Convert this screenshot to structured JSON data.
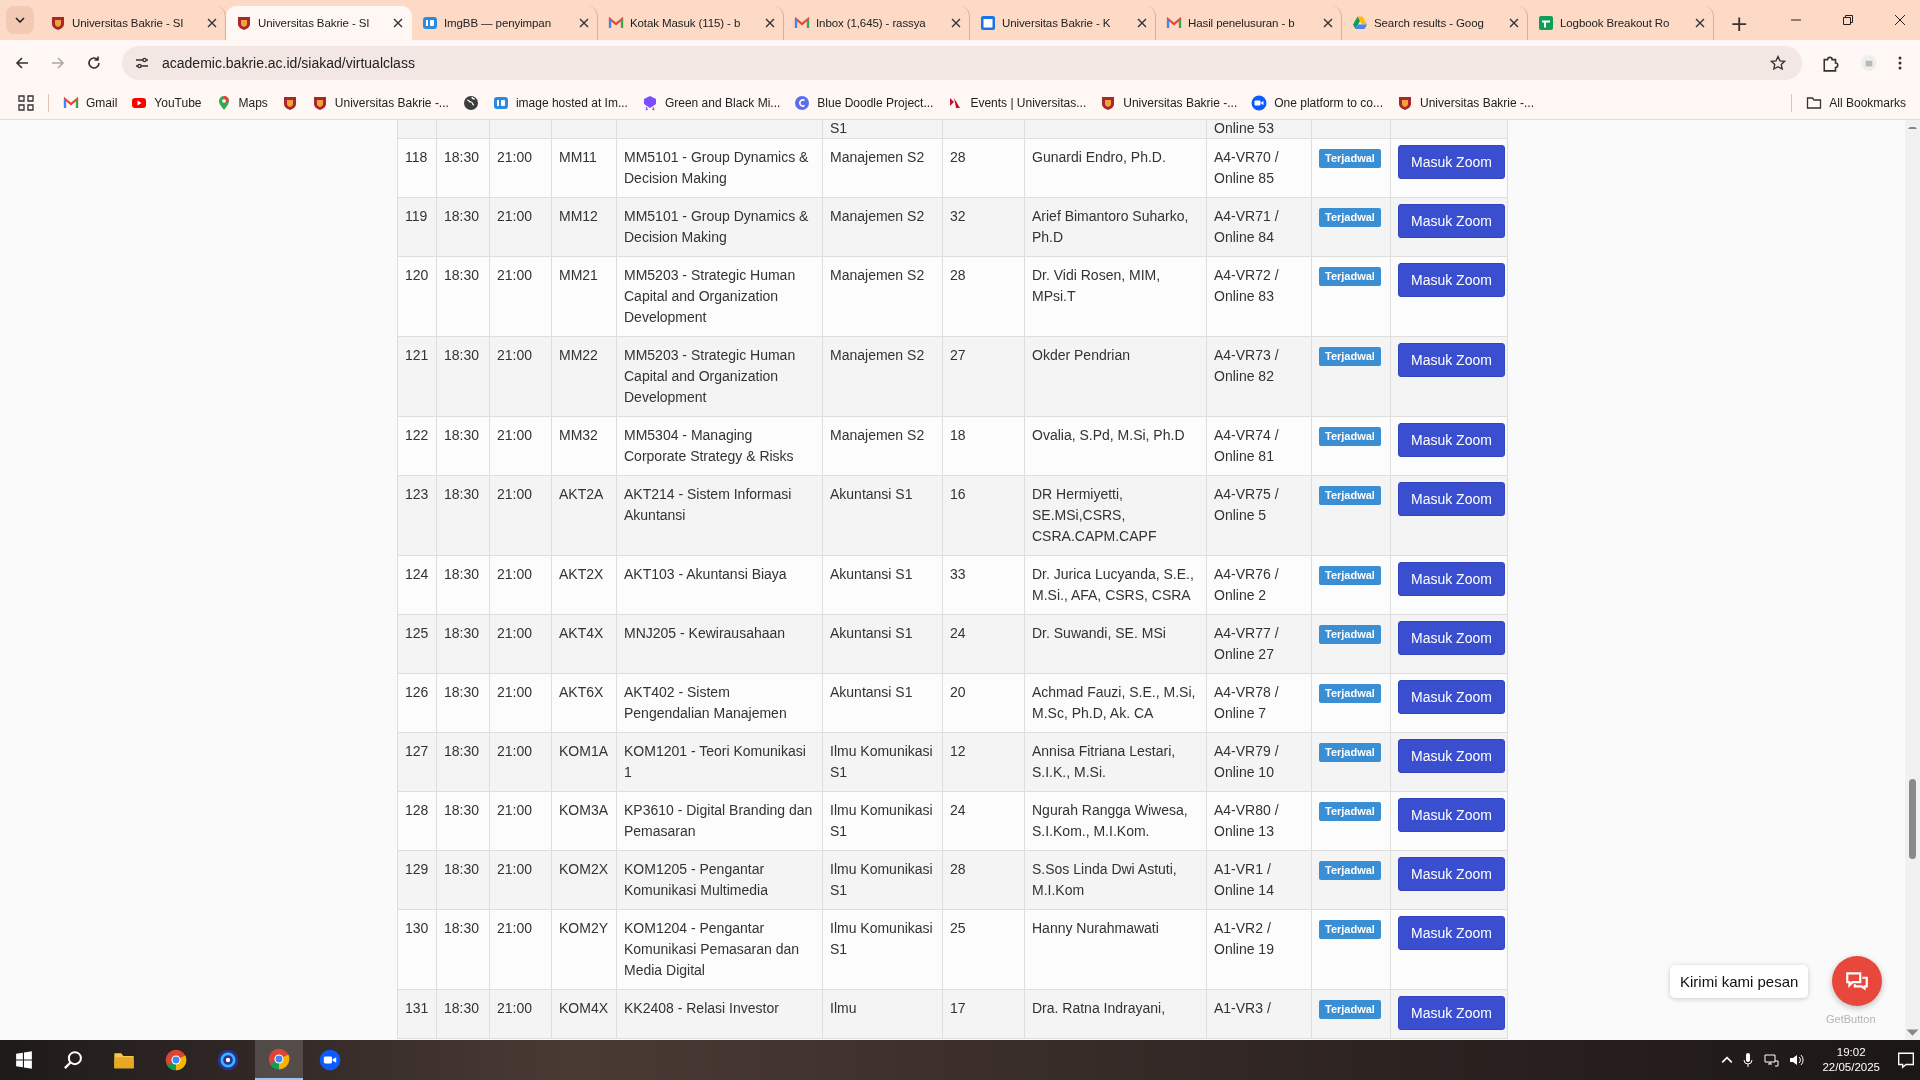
{
  "browser": {
    "tabs": [
      {
        "kind": "bakrie",
        "title": "Universitas Bakrie - SI",
        "selected": false
      },
      {
        "kind": "bakrie",
        "title": "Universitas Bakrie - SI",
        "selected": true
      },
      {
        "kind": "ibb",
        "title": "ImgBB — penyimpan",
        "selected": false
      },
      {
        "kind": "gmail",
        "title": "Kotak Masuk (115) - b",
        "selected": false
      },
      {
        "kind": "gmail",
        "title": "Inbox (1,645) - rassya",
        "selected": false
      },
      {
        "kind": "calendar",
        "title": "Universitas Bakrie - K",
        "selected": false
      },
      {
        "kind": "gmail",
        "title": "Hasil penelusuran - b",
        "selected": false
      },
      {
        "kind": "drive",
        "title": "Search results - Goog",
        "selected": false
      },
      {
        "kind": "sheets",
        "title": "Logbook Breakout Ro",
        "selected": false
      }
    ],
    "new_tab": "+",
    "address": "academic.bakrie.ac.id/siakad/virtualclass",
    "bookmarks": [
      {
        "kind": "gmail",
        "label": "Gmail"
      },
      {
        "kind": "youtube",
        "label": "YouTube"
      },
      {
        "kind": "maps",
        "label": "Maps"
      },
      {
        "kind": "bakrie"
      },
      {
        "kind": "bakrie",
        "label": "Universitas Bakrie -..."
      },
      {
        "kind": "globe"
      },
      {
        "kind": "ibb",
        "label": "image hosted at Im..."
      },
      {
        "kind": "badge",
        "label": "Green and Black Mi..."
      },
      {
        "kind": "doodle",
        "label": "Blue Doodle Project..."
      },
      {
        "kind": "events",
        "label": "Events | Universitas..."
      },
      {
        "kind": "bakrie",
        "label": "Universitas Bakrie -..."
      },
      {
        "kind": "zoom",
        "label": "One platform to co..."
      },
      {
        "kind": "bakrie",
        "label": "Universitas Bakrie -..."
      }
    ],
    "all_bookmarks": "All Bookmarks"
  },
  "table": {
    "partial_row": {
      "prodi": "S1",
      "room": "Online 53"
    },
    "rows": [
      {
        "no": "118",
        "start": "18:30",
        "end": "21:00",
        "code": "MM11",
        "course": "MM5101 - Group Dynamics & Decision Making",
        "prodi": "Manajemen S2",
        "participants": "28",
        "lecturer": "Gunardi Endro, Ph.D.",
        "room": "A4-VR70 / Online 85",
        "status": "Terjadwal",
        "action": "Masuk Zoom"
      },
      {
        "no": "119",
        "start": "18:30",
        "end": "21:00",
        "code": "MM12",
        "course": "MM5101 - Group Dynamics & Decision Making",
        "prodi": "Manajemen S2",
        "participants": "32",
        "lecturer": "Arief Bimantoro Suharko, Ph.D",
        "room": "A4-VR71 / Online 84",
        "status": "Terjadwal",
        "action": "Masuk Zoom"
      },
      {
        "no": "120",
        "start": "18:30",
        "end": "21:00",
        "code": "MM21",
        "course": "MM5203 - Strategic Human Capital and Organization Development",
        "prodi": "Manajemen S2",
        "participants": "28",
        "lecturer": "Dr. Vidi Rosen, MIM, MPsi.T",
        "room": "A4-VR72 / Online 83",
        "status": "Terjadwal",
        "action": "Masuk Zoom"
      },
      {
        "no": "121",
        "start": "18:30",
        "end": "21:00",
        "code": "MM22",
        "course": "MM5203 - Strategic Human Capital and Organization Development",
        "prodi": "Manajemen S2",
        "participants": "27",
        "lecturer": "Okder Pendrian",
        "room": "A4-VR73 / Online 82",
        "status": "Terjadwal",
        "action": "Masuk Zoom"
      },
      {
        "no": "122",
        "start": "18:30",
        "end": "21:00",
        "code": "MM32",
        "course": "MM5304 - Managing Corporate Strategy & Risks",
        "prodi": "Manajemen S2",
        "participants": "18",
        "lecturer": "Ovalia, S.Pd, M.Si, Ph.D",
        "room": "A4-VR74 / Online 81",
        "status": "Terjadwal",
        "action": "Masuk Zoom"
      },
      {
        "no": "123",
        "start": "18:30",
        "end": "21:00",
        "code": "AKT2A",
        "course": "AKT214 - Sistem Informasi Akuntansi",
        "prodi": "Akuntansi S1",
        "participants": "16",
        "lecturer": "DR Hermiyetti, SE.MSi,CSRS, CSRA.CAPM.CAPF",
        "room": "A4-VR75 / Online 5",
        "status": "Terjadwal",
        "action": "Masuk Zoom"
      },
      {
        "no": "124",
        "start": "18:30",
        "end": "21:00",
        "code": "AKT2X",
        "course": "AKT103 - Akuntansi Biaya",
        "prodi": "Akuntansi S1",
        "participants": "33",
        "lecturer": "Dr. Jurica Lucyanda, S.E., M.Si., AFA, CSRS, CSRA",
        "room": "A4-VR76 / Online 2",
        "status": "Terjadwal",
        "action": "Masuk Zoom"
      },
      {
        "no": "125",
        "start": "18:30",
        "end": "21:00",
        "code": "AKT4X",
        "course": "MNJ205 - Kewirausahaan",
        "prodi": "Akuntansi S1",
        "participants": "24",
        "lecturer": "Dr. Suwandi, SE. MSi",
        "room": "A4-VR77 / Online 27",
        "status": "Terjadwal",
        "action": "Masuk Zoom"
      },
      {
        "no": "126",
        "start": "18:30",
        "end": "21:00",
        "code": "AKT6X",
        "course": "AKT402 - Sistem Pengendalian Manajemen",
        "prodi": "Akuntansi S1",
        "participants": "20",
        "lecturer": "Achmad Fauzi, S.E., M.Si, M.Sc, Ph.D, Ak. CA",
        "room": "A4-VR78 / Online 7",
        "status": "Terjadwal",
        "action": "Masuk Zoom"
      },
      {
        "no": "127",
        "start": "18:30",
        "end": "21:00",
        "code": "KOM1A",
        "course": "KOM1201 - Teori Komunikasi 1",
        "prodi": "Ilmu Komunikasi S1",
        "participants": "12",
        "lecturer": "Annisa Fitriana Lestari, S.I.K., M.Si.",
        "room": "A4-VR79 / Online 10",
        "status": "Terjadwal",
        "action": "Masuk Zoom"
      },
      {
        "no": "128",
        "start": "18:30",
        "end": "21:00",
        "code": "KOM3A",
        "course": "KP3610 - Digital Branding dan Pemasaran",
        "prodi": "Ilmu Komunikasi S1",
        "participants": "24",
        "lecturer": "Ngurah Rangga Wiwesa, S.I.Kom., M.I.Kom.",
        "room": "A4-VR80 / Online 13",
        "status": "Terjadwal",
        "action": "Masuk Zoom"
      },
      {
        "no": "129",
        "start": "18:30",
        "end": "21:00",
        "code": "KOM2X",
        "course": "KOM1205 - Pengantar Komunikasi Multimedia",
        "prodi": "Ilmu Komunikasi S1",
        "participants": "28",
        "lecturer": "S.Sos Linda Dwi Astuti, M.I.Kom",
        "room": "A1-VR1 / Online 14",
        "status": "Terjadwal",
        "action": "Masuk Zoom"
      },
      {
        "no": "130",
        "start": "18:30",
        "end": "21:00",
        "code": "KOM2Y",
        "course": "KOM1204 - Pengantar Komunikasi Pemasaran dan Media Digital",
        "prodi": "Ilmu Komunikasi S1",
        "participants": "25",
        "lecturer": "Hanny Nurahmawati",
        "room": "A1-VR2 / Online 19",
        "status": "Terjadwal",
        "action": "Masuk Zoom"
      },
      {
        "no": "131",
        "start": "18:30",
        "end": "21:00",
        "code": "KOM4X",
        "course": "KK2408 - Relasi Investor",
        "prodi": "Ilmu",
        "participants": "17",
        "lecturer": "Dra. Ratna Indrayani,",
        "room": "A1-VR3 /",
        "status": "Terjadwal",
        "action": "Masuk Zoom"
      }
    ]
  },
  "chat_widget": {
    "tooltip": "Kirimi kami pesan",
    "credit": "GetButton"
  },
  "taskbar": {
    "time": "19:02",
    "date": "22/05/2025"
  }
}
